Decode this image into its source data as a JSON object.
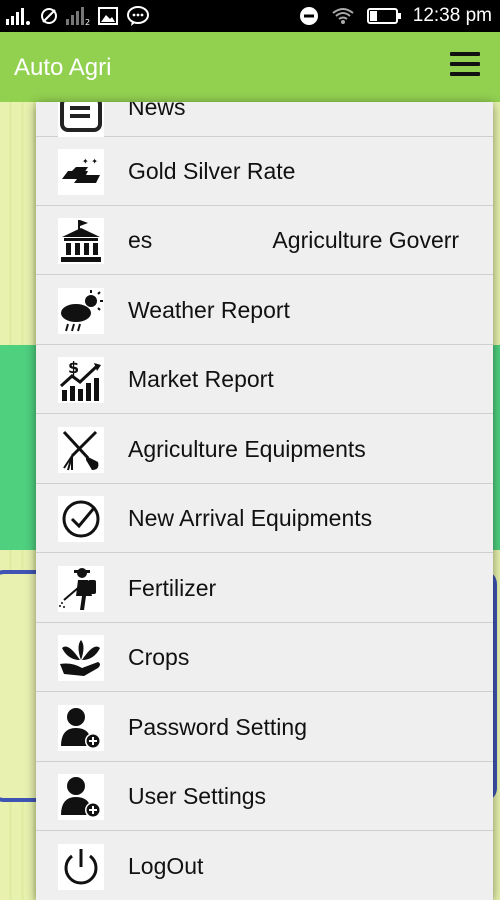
{
  "status_bar": {
    "time": "12:38",
    "ampm": "pm",
    "icons": [
      "signal-icon",
      "no-sim-icon",
      "signal-2-icon",
      "image-icon",
      "chat-icon",
      "do-not-disturb-icon",
      "wifi-icon",
      "battery-icon"
    ]
  },
  "app_bar": {
    "title": "Auto Agri",
    "menu_icon": "hamburger-menu-icon",
    "background": "#92d050"
  },
  "menu": {
    "items": [
      {
        "label": "News",
        "icon": "news-icon"
      },
      {
        "label": "Gold Silver Rate",
        "icon": "gold-bars-icon"
      },
      {
        "label": "es                   Agriculture Goverr",
        "icon": "government-building-icon"
      },
      {
        "label": "Weather Report",
        "icon": "weather-icon"
      },
      {
        "label": "Market Report",
        "icon": "market-chart-icon"
      },
      {
        "label": "Agriculture Equipments",
        "icon": "tools-icon"
      },
      {
        "label": "New Arrival Equipments",
        "icon": "check-circle-icon"
      },
      {
        "label": "Fertilizer",
        "icon": "sprayer-icon"
      },
      {
        "label": "Crops",
        "icon": "plant-hand-icon"
      },
      {
        "label": "Password Setting",
        "icon": "user-add-icon"
      },
      {
        "label": "User Settings",
        "icon": "user-add-icon"
      },
      {
        "label": "LogOut",
        "icon": "power-icon"
      }
    ]
  },
  "colors": {
    "accent_green": "#92d050",
    "mint": "#4fd07f",
    "card_border": "#3f55b5"
  }
}
